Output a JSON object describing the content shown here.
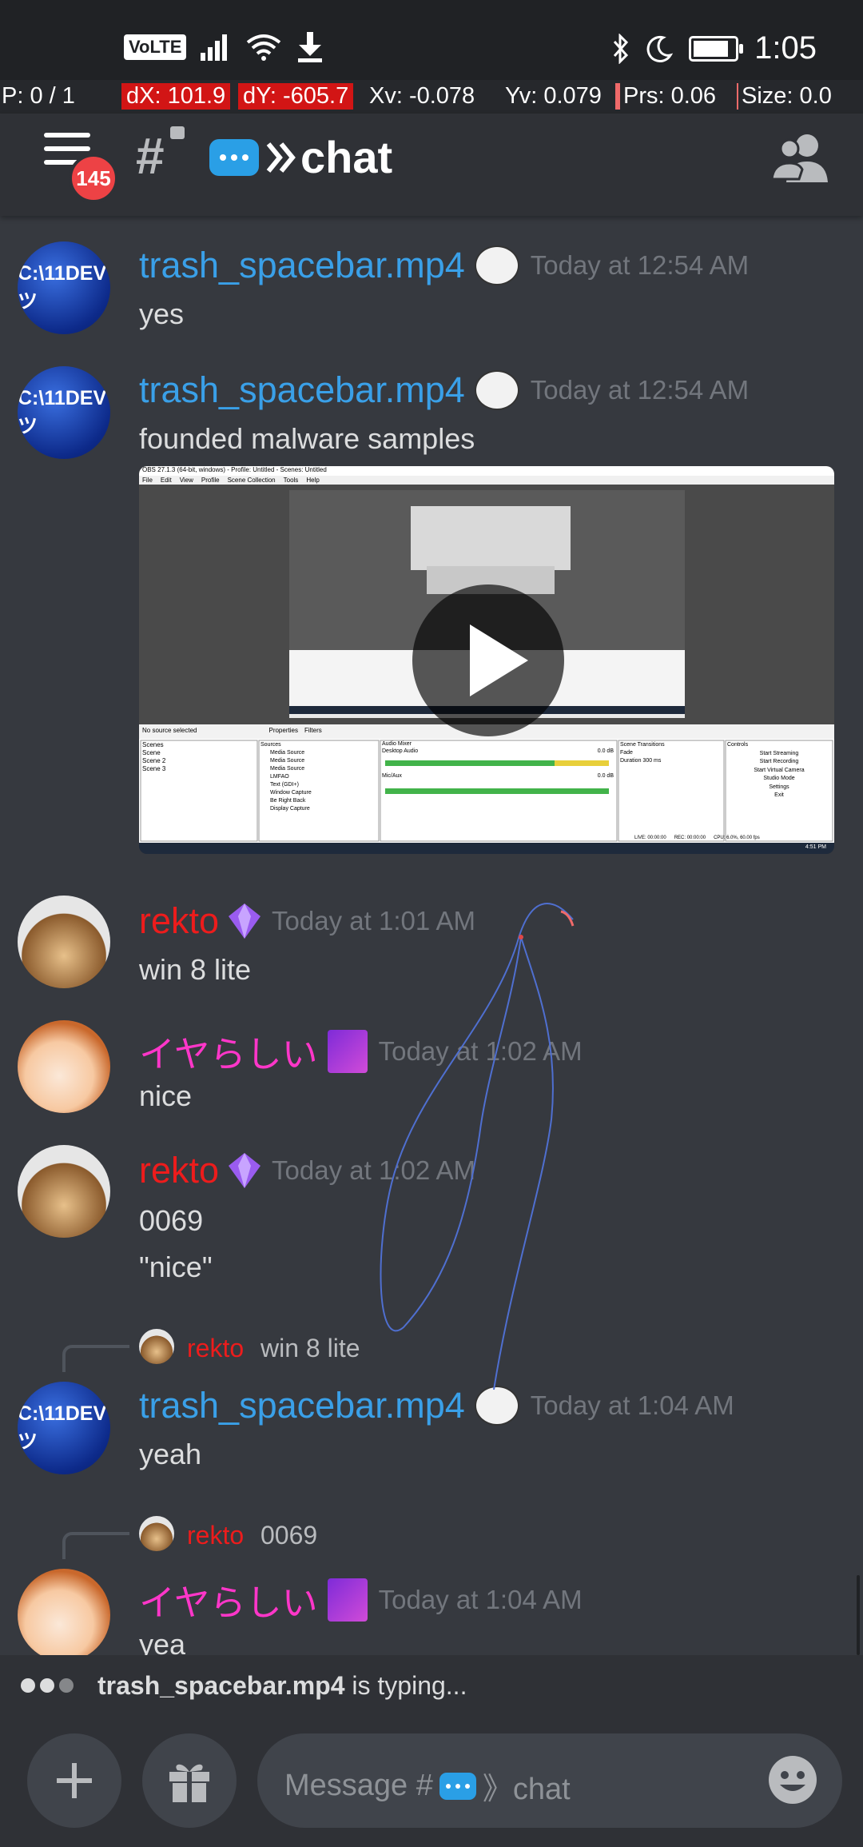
{
  "status_bar": {
    "time": "1:05",
    "volte": "VoLTE",
    "battery_level": 0.85
  },
  "debug_overlay": {
    "pointer": "P: 0 / 1",
    "dx": "dX: 101.9",
    "dy": "dY: -605.7",
    "xv": "Xv: -0.078",
    "yv": "Yv: 0.079",
    "prs": "Prs: 0.06",
    "size": "Size: 0.0"
  },
  "top_bar": {
    "badge_count": "145",
    "channel_name": "chat"
  },
  "messages": [
    {
      "user": "trash_spacebar.mp4",
      "avatar_text": "C:\\11DEVツ",
      "timestamp": "Today at 12:54 AM",
      "lines": [
        "yes"
      ]
    },
    {
      "user": "trash_spacebar.mp4",
      "avatar_text": "C:\\11DEVツ",
      "timestamp": "Today at 12:54 AM",
      "lines": [
        "founded malware samples"
      ]
    },
    {
      "user": "rekto",
      "timestamp": "Today at 1:01 AM",
      "lines": [
        "win 8 lite"
      ]
    },
    {
      "user": "イヤらしい",
      "timestamp": "Today at 1:02 AM",
      "lines": [
        "nice"
      ]
    },
    {
      "user": "rekto",
      "timestamp": "Today at 1:02 AM",
      "lines": [
        "0069",
        "\"nice\""
      ]
    },
    {
      "user": "trash_spacebar.mp4",
      "avatar_text": "C:\\11DEVツ",
      "timestamp": "Today at 1:04 AM",
      "lines": [
        "yeah"
      ],
      "reply": {
        "user": "rekto",
        "text": "win 8 lite"
      }
    },
    {
      "user": "イヤらしい",
      "timestamp": "Today at 1:04 AM",
      "lines": [
        "yea"
      ],
      "reply": {
        "user": "rekto",
        "text": "0069"
      }
    }
  ],
  "video_embed": {
    "window_title": "OBS 27.1.3 (64-bit, windows) - Profile: Untitled - Scenes: Untitled",
    "menu": [
      "File",
      "Edit",
      "View",
      "Profile",
      "Scene Collection",
      "Tools",
      "Help"
    ],
    "source_label": "No source selected",
    "properties": "Properties",
    "filters": "Filters",
    "panels": {
      "scenes": {
        "title": "Scenes",
        "items": [
          "Scene",
          "Scene 2",
          "Scene 3"
        ]
      },
      "sources": {
        "title": "Sources",
        "items": [
          "Media Source",
          "Media Source",
          "Media Source",
          "LMFAO",
          "Text (GDI+)",
          "Window Capture",
          "Be Right Back",
          "Display Capture"
        ]
      },
      "mixer": {
        "title": "Audio Mixer",
        "channels": [
          "Desktop Audio",
          "Mic/Aux"
        ],
        "levels": [
          "0.0 dB",
          "0.0 dB"
        ]
      },
      "transitions": {
        "title": "Scene Transitions",
        "type": "Fade",
        "duration_label": "Duration",
        "duration": "300 ms"
      },
      "controls": {
        "title": "Controls",
        "buttons": [
          "Start Streaming",
          "Start Recording",
          "Start Virtual Camera",
          "Studio Mode",
          "Settings",
          "Exit"
        ]
      }
    },
    "statusbar": {
      "live": "LIVE: 00:00:00",
      "rec": "REC: 00:00:00",
      "cpu": "CPU: 6.0%, 60.00 fps"
    },
    "clock": "4:51 PM"
  },
  "typing": {
    "user": "trash_spacebar.mp4",
    "suffix": " is typing..."
  },
  "composer": {
    "placeholder_prefix": "Message #",
    "placeholder_channel": "》chat"
  },
  "colors": {
    "background": "#36393f",
    "bar": "#2f3136",
    "user_blue": "#3aa0e8",
    "user_red": "#ed1c1c",
    "user_pink": "#ff36c9",
    "timestamp": "#72767d",
    "badge": "#ed4245",
    "gesture_trace": "#4f6fd0"
  }
}
